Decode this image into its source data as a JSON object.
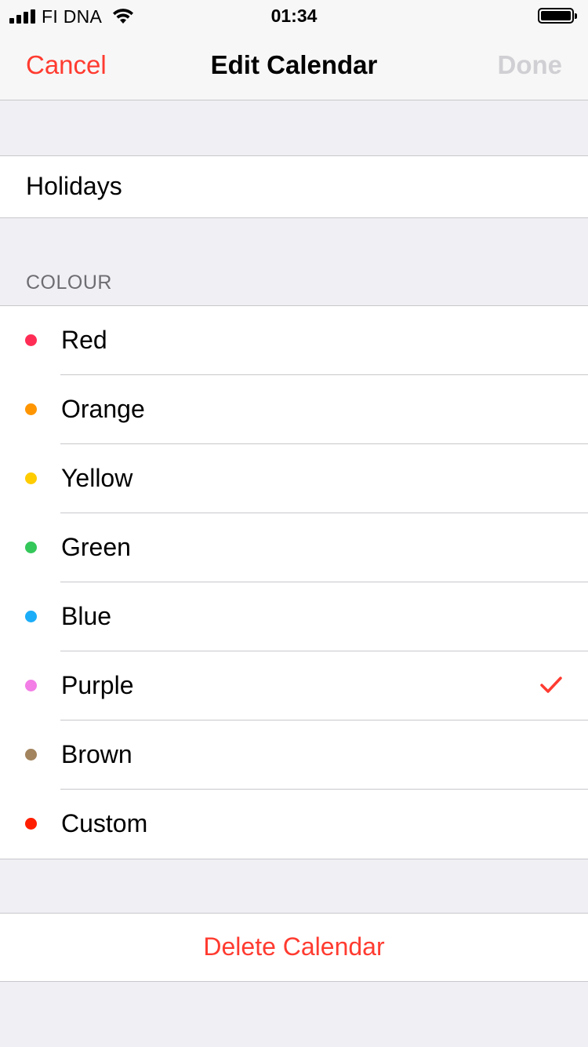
{
  "status_bar": {
    "carrier": "FI DNA",
    "time": "01:34",
    "icons": [
      "signal-icon",
      "wifi-icon",
      "battery-icon"
    ]
  },
  "nav": {
    "cancel_label": "Cancel",
    "title": "Edit Calendar",
    "done_label": "Done"
  },
  "calendar": {
    "name": "Holidays"
  },
  "colour_section": {
    "header": "COLOUR",
    "selected": "Purple",
    "options": [
      {
        "label": "Red",
        "color": "#ff2d55"
      },
      {
        "label": "Orange",
        "color": "#ff9500"
      },
      {
        "label": "Yellow",
        "color": "#ffcc00"
      },
      {
        "label": "Green",
        "color": "#34c759"
      },
      {
        "label": "Blue",
        "color": "#1badf8"
      },
      {
        "label": "Purple",
        "color": "#f27ee6"
      },
      {
        "label": "Brown",
        "color": "#a2845e"
      },
      {
        "label": "Custom",
        "color": "#ff1e00"
      }
    ]
  },
  "accent_color": "#ff3b30",
  "delete_label": "Delete Calendar"
}
